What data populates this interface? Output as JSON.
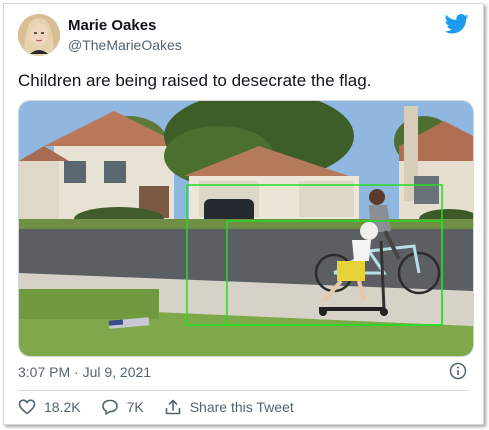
{
  "author": {
    "name": "Marie Oakes",
    "handle": "@TheMarieOakes"
  },
  "tweet": {
    "text": "Children are being raised to desecrate the flag.",
    "timestamp": "3:07 PM · Jul 9, 2021"
  },
  "actions": {
    "likes": "18.2K",
    "replies": "7K",
    "share_label": "Share this Tweet"
  },
  "icons": {
    "brand": "twitter-bird-icon",
    "info": "info-icon",
    "like": "heart-icon",
    "reply": "reply-bubble-icon",
    "share": "share-icon"
  },
  "colors": {
    "brand": "#1d9bf0",
    "secondary_text": "#536471",
    "detection_box": "#22dd22"
  }
}
